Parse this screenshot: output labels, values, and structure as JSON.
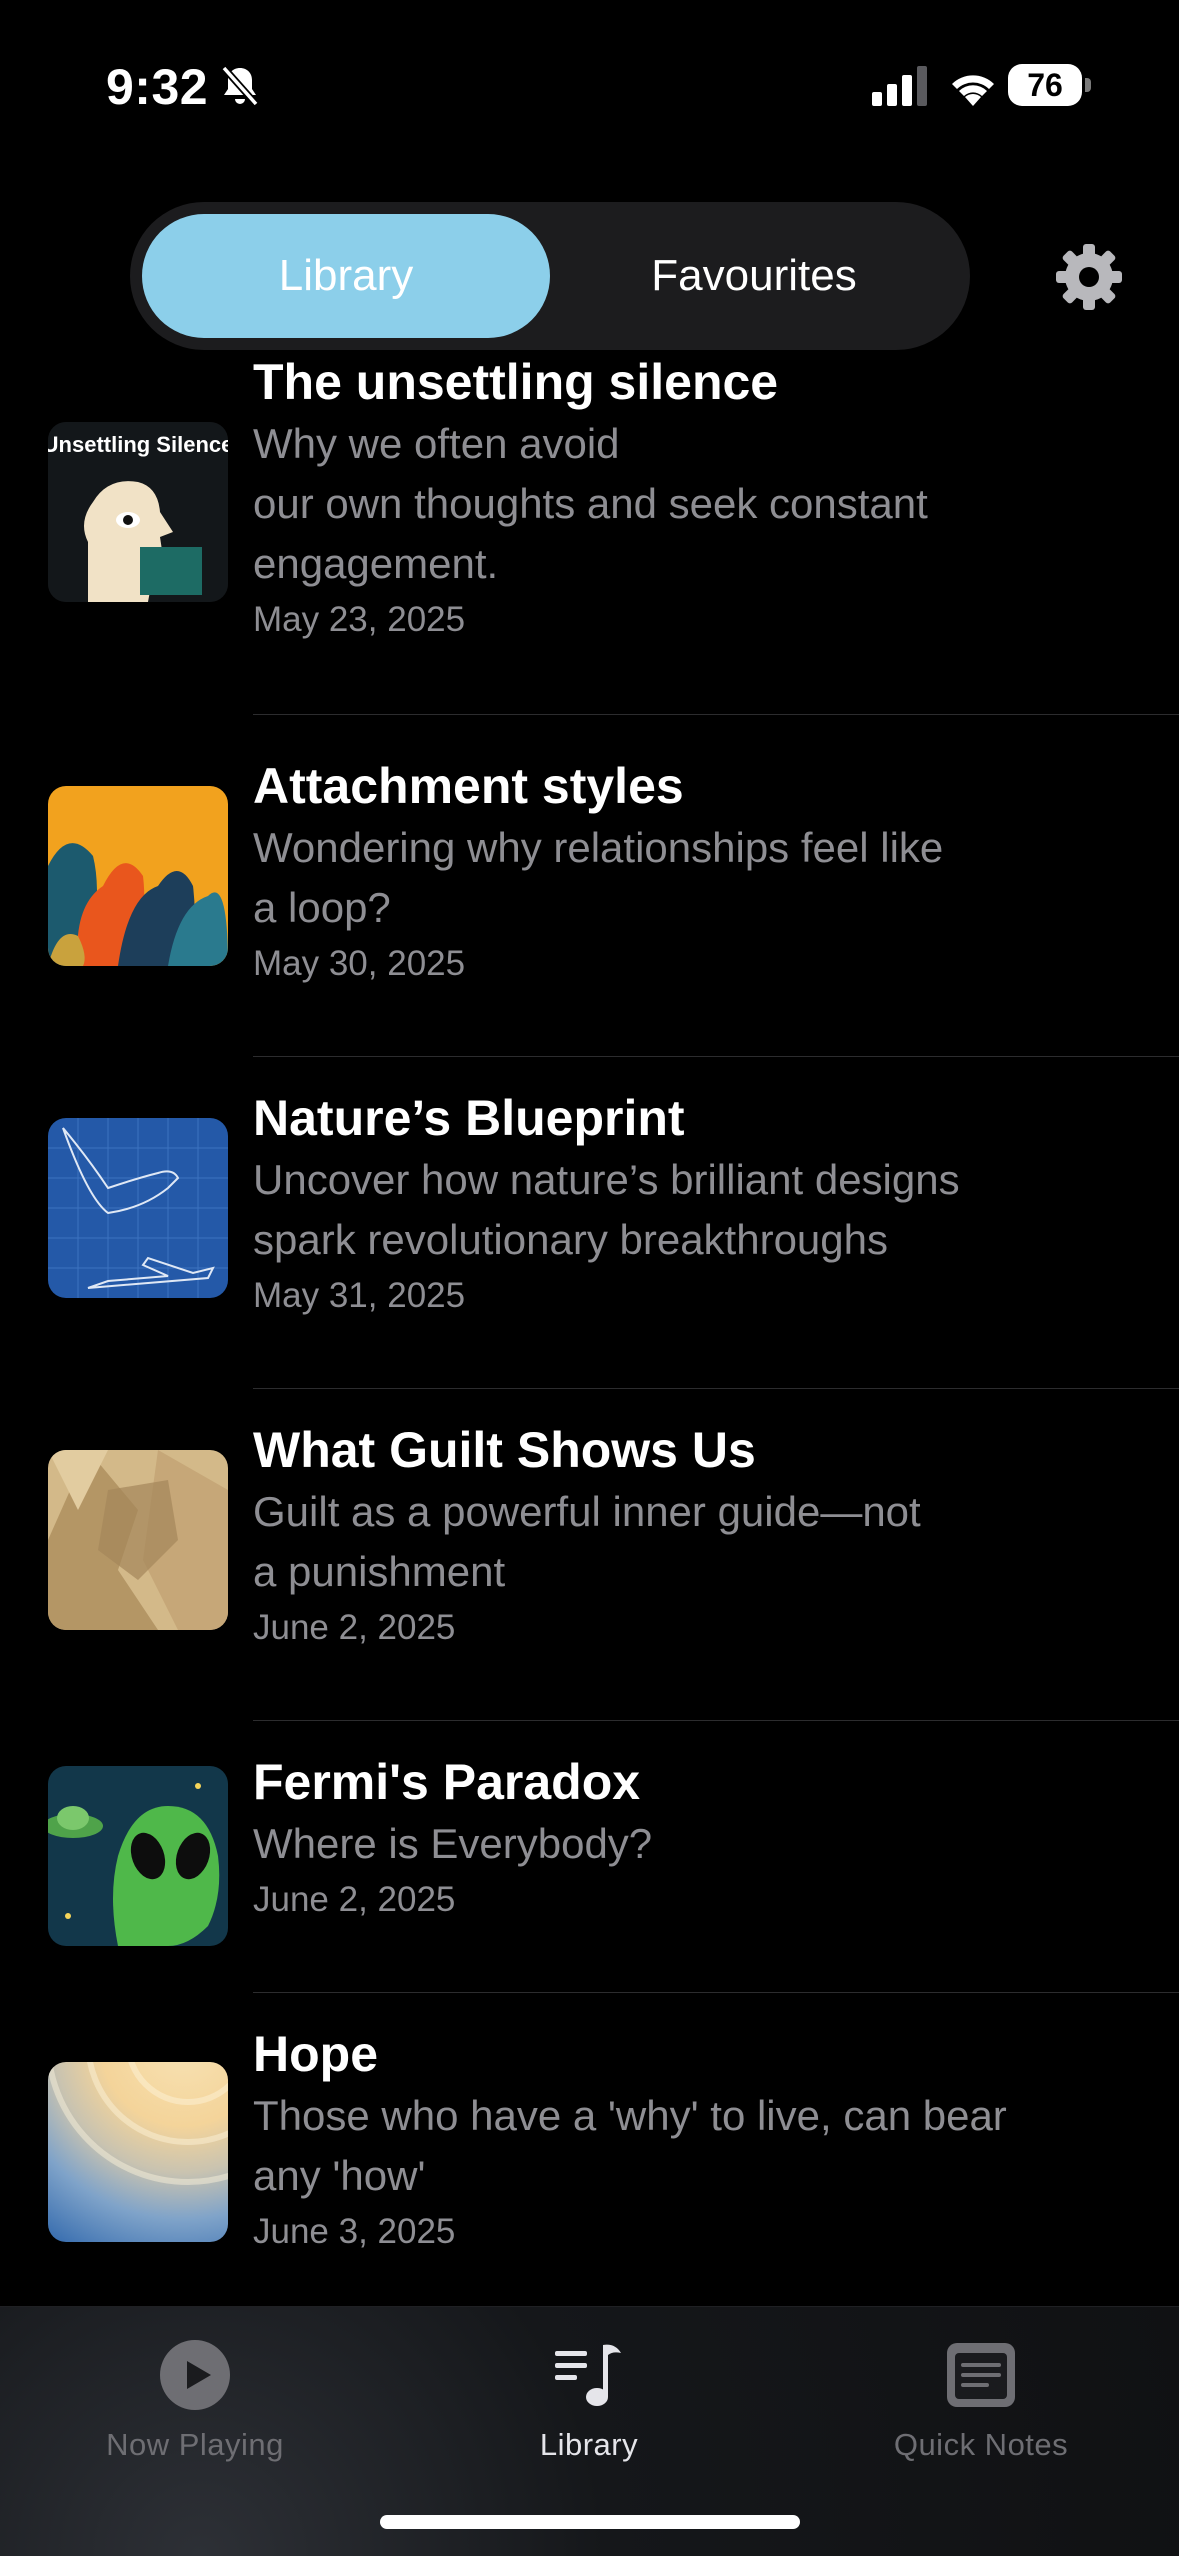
{
  "status_bar": {
    "time": "9:32",
    "battery": "76"
  },
  "segmented": {
    "library_label": "Library",
    "favourites_label": "Favourites"
  },
  "icons": {
    "settings": "gear-icon",
    "silent": "bell-slash-icon"
  },
  "episodes": [
    {
      "title": "The unsettling silence",
      "subtitle": "Why we often avoid\nour own thoughts and seek constant engagement.",
      "date": "May 23, 2025",
      "thumb_text": "Unsettling Silence"
    },
    {
      "title": "Attachment styles",
      "subtitle": "Wondering why relationships feel like a loop?",
      "date": "May 30, 2025"
    },
    {
      "title": "Nature’s Blueprint",
      "subtitle": "Uncover how nature’s brilliant designs spark revolutionary breakthroughs",
      "date": "May 31, 2025"
    },
    {
      "title": "What Guilt Shows Us",
      "subtitle": "Guilt as a powerful inner guide—not a punishment",
      "date": "June 2, 2025"
    },
    {
      "title": "Fermi's Paradox",
      "subtitle": "Where is Everybody?",
      "date": "June 2, 2025"
    },
    {
      "title": "Hope",
      "subtitle": "Those who have a 'why' to live, can bear any 'how'",
      "date": "June 3, 2025"
    }
  ],
  "tabbar": {
    "now_playing": "Now Playing",
    "library": "Library",
    "quick_notes": "Quick Notes"
  },
  "colors": {
    "accent": "#8ccfea",
    "background": "#000000",
    "secondary_text": "#8e8e93"
  }
}
